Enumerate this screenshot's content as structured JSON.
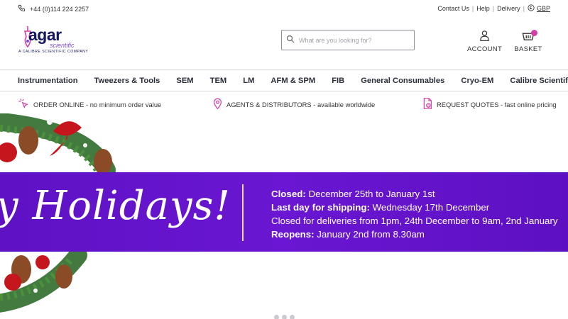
{
  "topbar": {
    "phone": "+44 (0)114 224 2257",
    "links": {
      "contact": "Contact Us",
      "help": "Help",
      "delivery": "Delivery",
      "currency": "GBP"
    }
  },
  "header": {
    "logo": {
      "word": "agar",
      "sub": "scientific",
      "tagline": "A CALIBRE SCIENTIFIC COMPANY"
    },
    "search": {
      "placeholder": "What are you looking for?"
    },
    "account_label": "ACCOUNT",
    "basket_label": "BASKET"
  },
  "nav": {
    "items": [
      "Instrumentation",
      "Tweezers & Tools",
      "SEM",
      "TEM",
      "LM",
      "AFM & SPM",
      "FIB",
      "General Consumables",
      "Cryo-EM",
      "Calibre Scientific"
    ]
  },
  "usps": [
    {
      "icon": "click-icon",
      "title": "ORDER ONLINE",
      "text": " - no minimum order value"
    },
    {
      "icon": "location-pin-icon",
      "title": "AGENTS & DISTRIBUTORS",
      "text": " - available worldwide"
    },
    {
      "icon": "quote-document-icon",
      "title": "REQUEST QUOTES",
      "text": " - fast online pricing"
    }
  ],
  "hero": {
    "script_text": "y Holidays!",
    "lines": [
      {
        "label": "Closed:",
        "text": " December 25th to January 1st"
      },
      {
        "label": "Last day for shipping:",
        "text": " Wednesday 17th December"
      },
      {
        "label": "",
        "text": "Closed for deliveries from 1pm, 24th December to 9am, 2nd January"
      },
      {
        "label": "Reopens:",
        "text": " January 2nd from 8.30am"
      }
    ],
    "slide_count": 3
  },
  "colors": {
    "brand_navy": "#15185e",
    "brand_pink": "#d13fa6",
    "banner_purple": "#6312cb"
  }
}
